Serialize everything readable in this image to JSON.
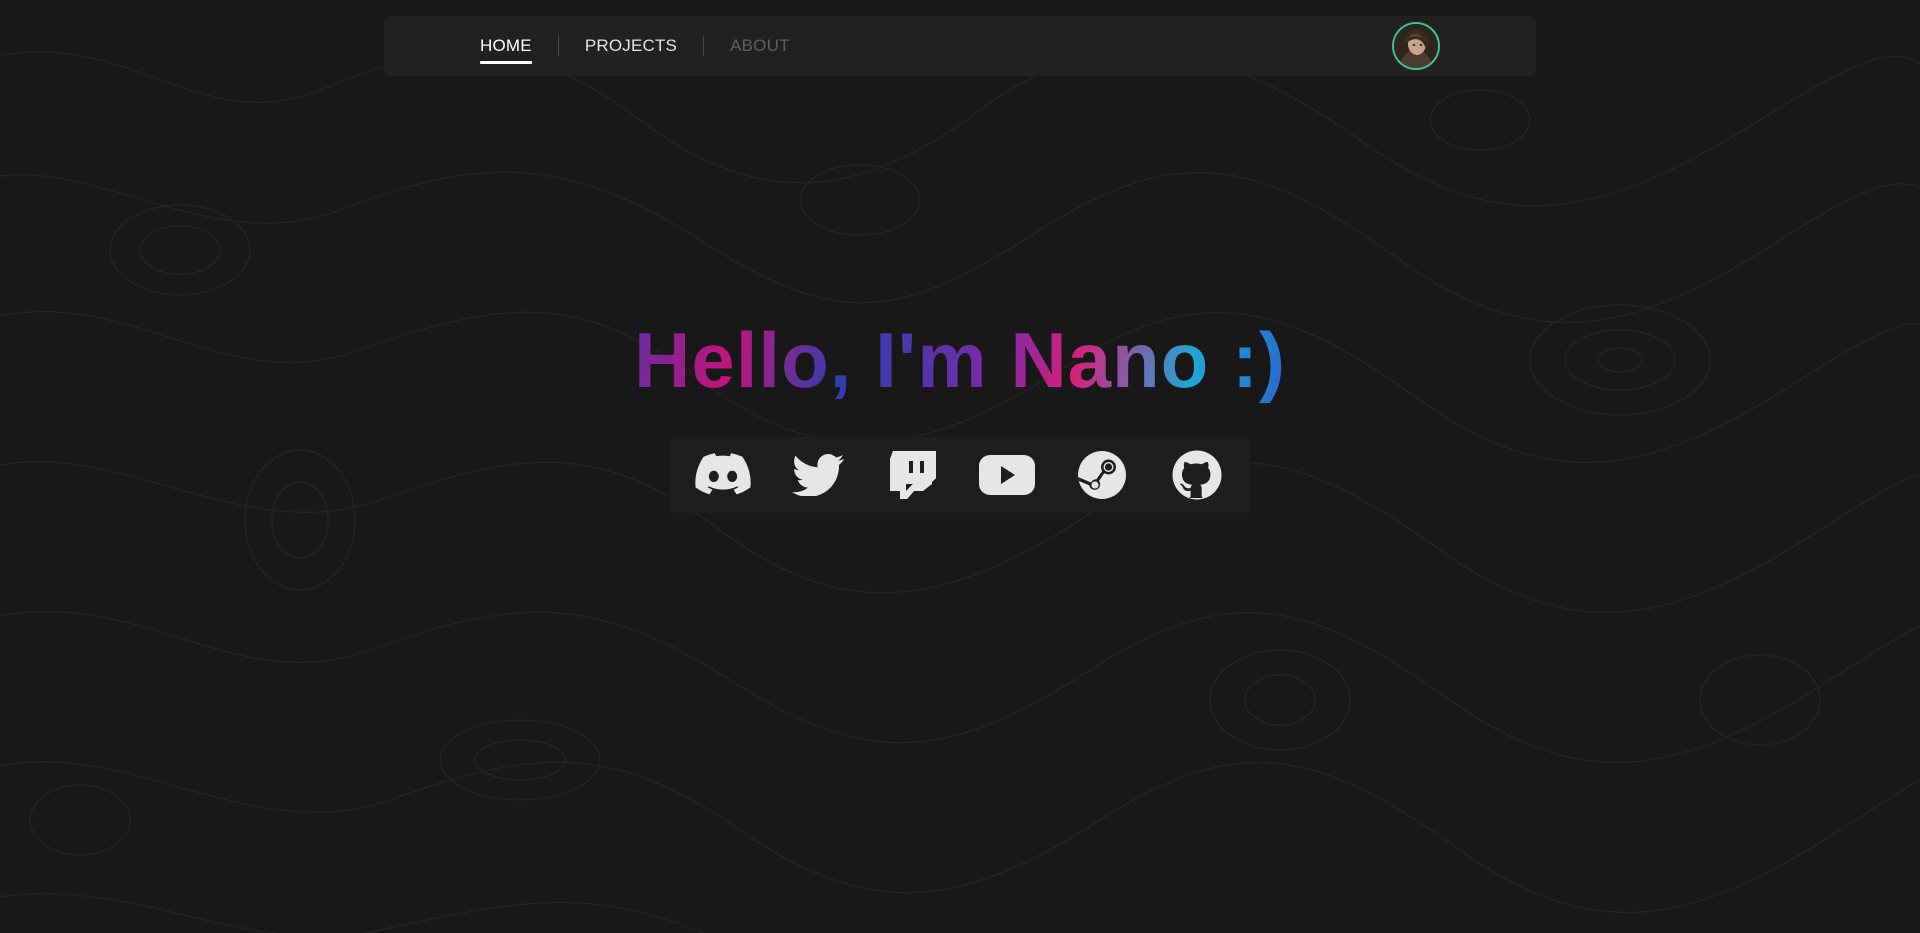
{
  "nav": {
    "links": [
      {
        "label": "HOME",
        "state": "active"
      },
      {
        "label": "PROJECTS",
        "state": "normal"
      },
      {
        "label": "ABOUT",
        "state": "disabled"
      }
    ],
    "avatar_ring_color": "#3ec48d"
  },
  "hero": {
    "title": "Hello, I'm Nano :)"
  },
  "social": [
    {
      "icon": "discord-icon"
    },
    {
      "icon": "twitter-icon"
    },
    {
      "icon": "twitch-icon"
    },
    {
      "icon": "youtube-icon"
    },
    {
      "icon": "steam-icon"
    },
    {
      "icon": "github-icon"
    }
  ],
  "colors": {
    "background": "#181818",
    "navbar": "#212121",
    "icon": "#e6e6e6"
  }
}
